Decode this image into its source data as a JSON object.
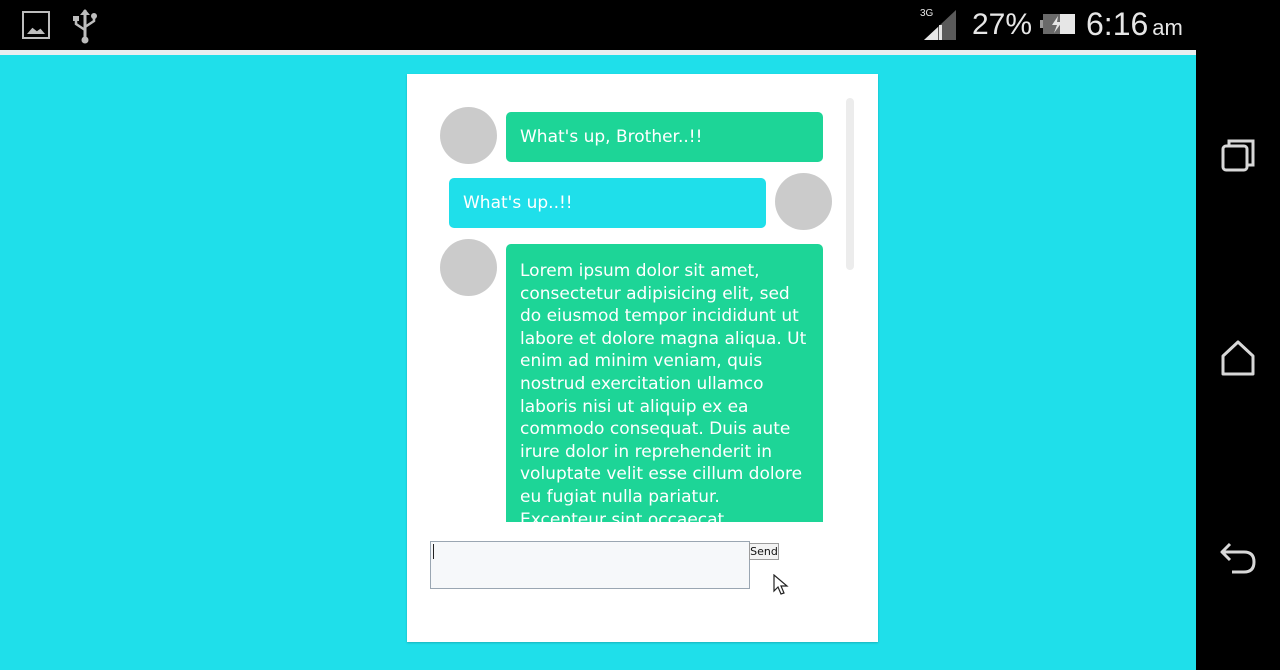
{
  "status_bar": {
    "network_type": "3G",
    "battery_percent": "27%",
    "time": "6:16",
    "ampm": "am",
    "icons": [
      "gallery-icon",
      "usb-icon",
      "signal-icon",
      "battery-icon"
    ]
  },
  "nav_bar": {
    "icons": [
      "recents-icon",
      "home-icon",
      "back-icon"
    ]
  },
  "chat": {
    "messages": [
      {
        "side": "left",
        "color": "#1dd597",
        "text": "What's up, Brother..!!"
      },
      {
        "side": "right",
        "color": "#1fdfea",
        "text": "What's up..!!"
      },
      {
        "side": "left",
        "color": "#1dd597",
        "text": "Lorem ipsum dolor sit amet, consectetur adipisicing elit, sed do eiusmod tempor incididunt ut labore et dolore magna aliqua. Ut enim ad minim veniam, quis nostrud exercitation ullamco laboris nisi ut aliquip ex ea commodo consequat. Duis aute irure dolor in reprehenderit in voluptate velit esse cillum dolore eu fugiat nulla pariatur. Excepteur sint occaecat cupidatat non"
      }
    ]
  },
  "compose": {
    "input_value": "",
    "send_label": "Send"
  },
  "colors": {
    "background": "#1fdfea",
    "bubble_green": "#1dd597",
    "bubble_cyan": "#1fdfea",
    "avatar": "#cbcbcb"
  }
}
